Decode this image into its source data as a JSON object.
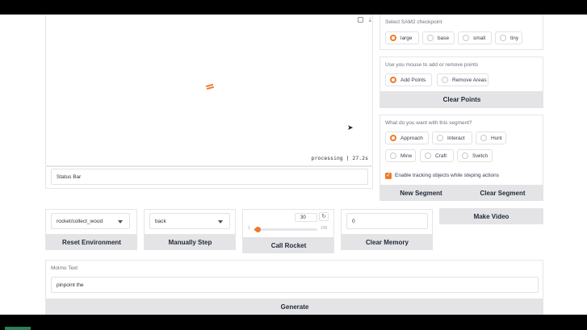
{
  "canvas": {
    "status_overlay": "processing | 27.2s",
    "fullscreen_icon": "fullscreen-icon",
    "download_icon": "download-icon"
  },
  "status_bar": {
    "value": "Status Bar"
  },
  "checkpoint": {
    "label": "Select SAM2 checkpoint",
    "options": [
      "large",
      "base",
      "small",
      "tiny"
    ],
    "selected": "large"
  },
  "points": {
    "label": "Use you mouse to add or remove points",
    "options": [
      "Add Points",
      "Remove Areas"
    ],
    "selected": "Add Points",
    "clear_label": "Clear Points"
  },
  "segment": {
    "label": "What do you want with this segment?",
    "options": [
      "Approach",
      "Interact",
      "Hunt",
      "Mine",
      "Craft",
      "Switch"
    ],
    "selected": "Approach",
    "tracking_label": "Enable tracking objects while steping actions",
    "tracking_checked": true,
    "new_label": "New Segment",
    "clear_label": "Clear Segment"
  },
  "controls": {
    "env_value": "rocket/collect_wood",
    "reset_label": "Reset Environment",
    "step_value": "back",
    "step_label": "Manually Step",
    "rocket_number": "30",
    "slider_min": "1",
    "slider_max": "100",
    "slider_level": 0.03,
    "call_rocket_label": "Call Rocket",
    "memory_value": "0",
    "clear_memory_label": "Clear Memory",
    "make_video_label": "Make Video"
  },
  "molmo": {
    "label": "Molmo Text",
    "value": "pinpoint the",
    "generate_label": "Generate"
  },
  "colors": {
    "accent": "#ee7a2c",
    "button_bg": "#e4e4e7"
  }
}
